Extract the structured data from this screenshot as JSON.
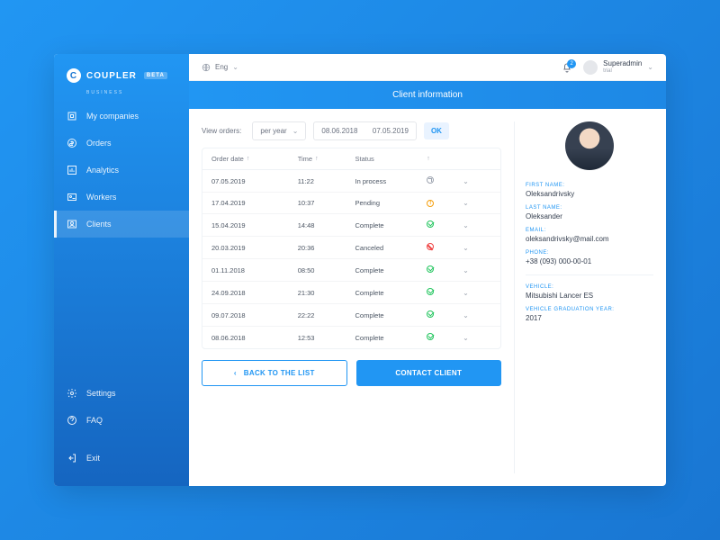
{
  "logo": {
    "text": "COUPLER",
    "badge": "BETA",
    "sub": "BUSINESS"
  },
  "nav": {
    "items": [
      {
        "label": "My companies"
      },
      {
        "label": "Orders"
      },
      {
        "label": "Analytics"
      },
      {
        "label": "Workers"
      },
      {
        "label": "Clients"
      },
      {
        "label": "Settings"
      },
      {
        "label": "FAQ"
      }
    ],
    "exit": "Exit"
  },
  "topbar": {
    "lang": "Eng",
    "notifications": "2",
    "user": {
      "name": "Superadmin",
      "role": "trial"
    }
  },
  "header": "Client information",
  "filters": {
    "label": "View orders:",
    "period": "per year",
    "date_from": "08.06.2018",
    "date_to": "07.05.2019",
    "ok": "OK"
  },
  "table": {
    "columns": {
      "order_date": "Order date",
      "time": "Time",
      "status": "Status"
    },
    "rows": [
      {
        "date": "07.05.2019",
        "time": "11:22",
        "status": "In process",
        "status_type": "process"
      },
      {
        "date": "17.04.2019",
        "time": "10:37",
        "status": "Pending",
        "status_type": "pending"
      },
      {
        "date": "15.04.2019",
        "time": "14:48",
        "status": "Complete",
        "status_type": "complete"
      },
      {
        "date": "20.03.2019",
        "time": "20:36",
        "status": "Canceled",
        "status_type": "cancel"
      },
      {
        "date": "01.11.2018",
        "time": "08:50",
        "status": "Complete",
        "status_type": "complete"
      },
      {
        "date": "24.09.2018",
        "time": "21:30",
        "status": "Complete",
        "status_type": "complete"
      },
      {
        "date": "09.07.2018",
        "time": "22:22",
        "status": "Complete",
        "status_type": "complete"
      },
      {
        "date": "08.06.2018",
        "time": "12:53",
        "status": "Complete",
        "status_type": "complete"
      }
    ]
  },
  "actions": {
    "back": "BACK TO THE LIST",
    "contact": "CONTACT CLIENT"
  },
  "client": {
    "first_name": {
      "label": "FIRST NAME:",
      "value": "Oleksandrivsky"
    },
    "last_name": {
      "label": "LAST NAME:",
      "value": "Oleksander"
    },
    "email": {
      "label": "EMAIL:",
      "value": "oleksandrivsky@mail.com"
    },
    "phone": {
      "label": "PHONE:",
      "value": "+38 (093) 000-00-01"
    },
    "vehicle": {
      "label": "VEHICLE:",
      "value": "Mitsubishi Lancer ES"
    },
    "year": {
      "label": "VEHICLE GRADUATION YEAR:",
      "value": "2017"
    }
  }
}
